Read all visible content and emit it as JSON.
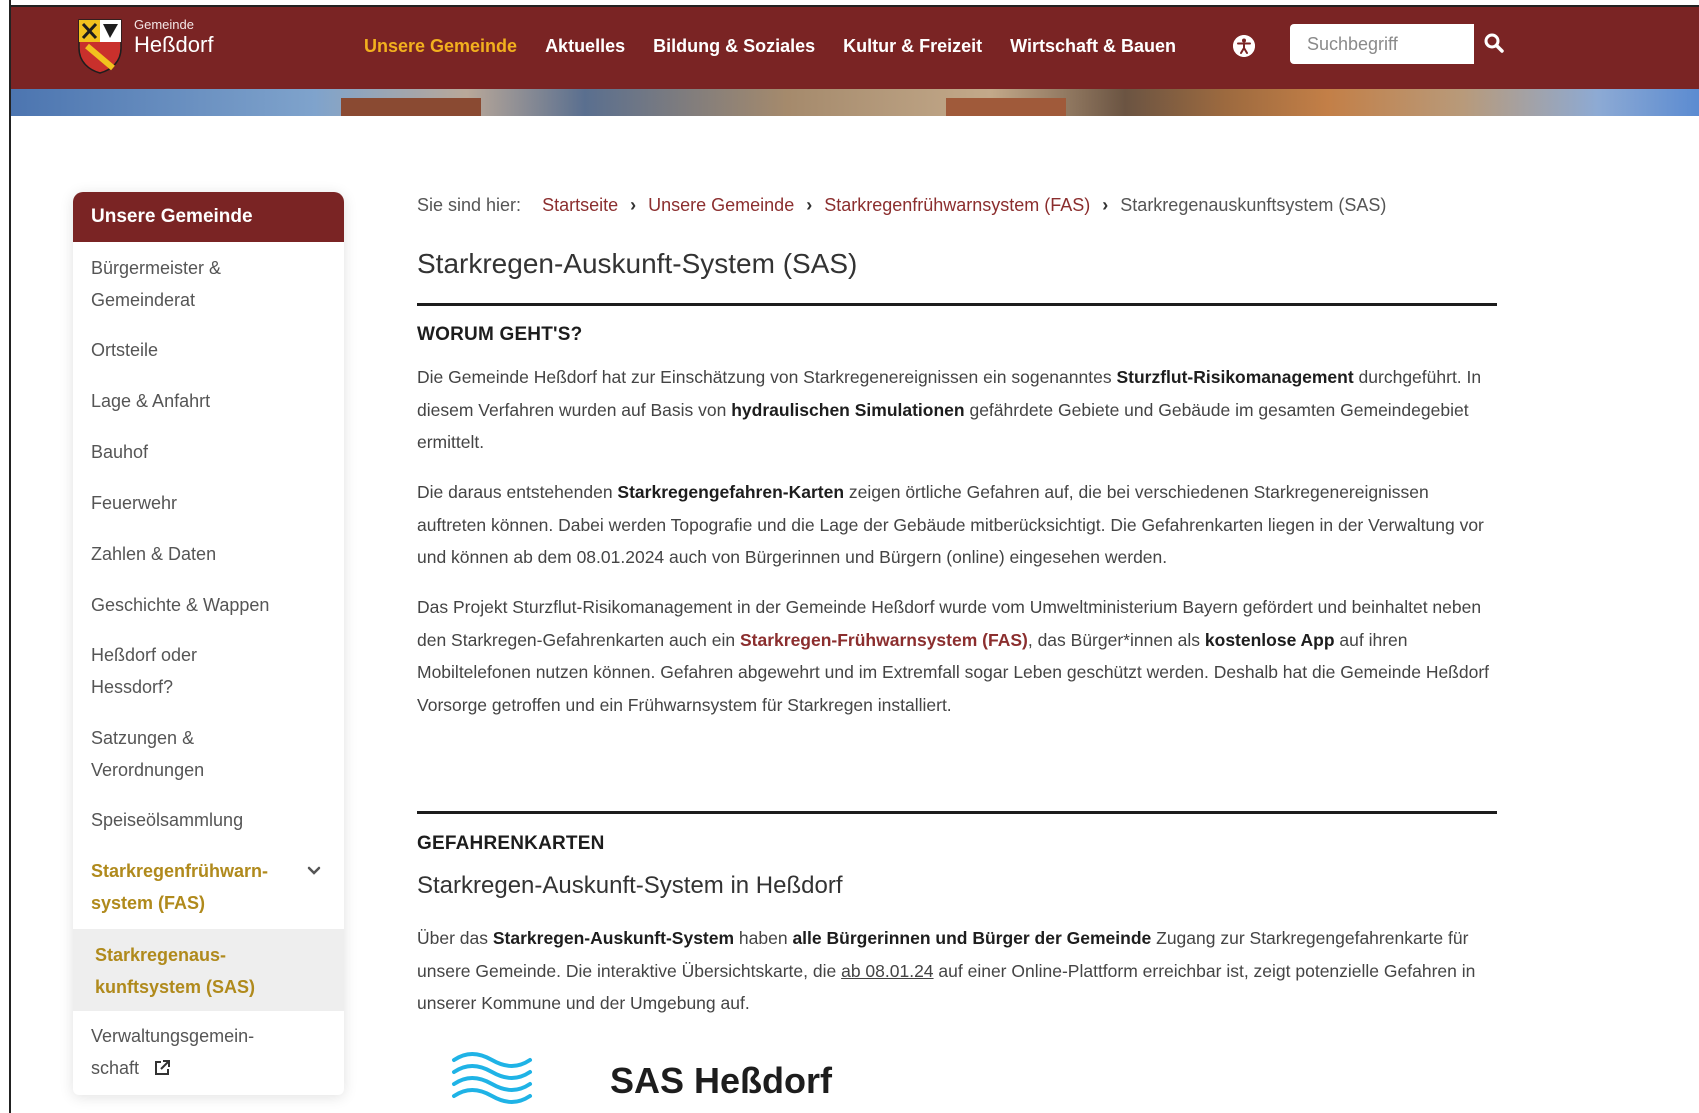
{
  "header": {
    "logo_sub": "Gemeinde",
    "logo_main": "Heßdorf",
    "nav": [
      "Unsere Gemeinde",
      "Aktuelles",
      "Bildung & Soziales",
      "Kultur & Freizeit",
      "Wirtschaft & Bauen"
    ],
    "search_placeholder": "Suchbegriff",
    "colors": {
      "brand": "#7a2424",
      "nav_active": "#f2b01e"
    }
  },
  "sidebar": {
    "title": "Unsere Gemeinde",
    "items": [
      "Bürgermeister &",
      "Gemeinderat",
      "Ortsteile",
      "Lage & Anfahrt",
      "Bauhof",
      "Feuerwehr",
      "Zahlen & Daten",
      "Geschichte & Wappen",
      "Heßdorf oder",
      "Hessdorf?",
      "Satzungen &",
      "Verordnungen",
      "Speiseölsammlung",
      "Starkregenfrühwarn-",
      "system (FAS)",
      "Starkregenaus-",
      "kunftsystem (SAS)",
      "Verwaltungsgemein-",
      "schaft"
    ],
    "colors": {
      "highlight": "#b08a1c"
    }
  },
  "breadcrumb": {
    "prefix": "Sie sind hier:",
    "links": [
      "Startseite",
      "Unsere Gemeinde",
      "Starkregenfrühwarnsystem (FAS)"
    ],
    "current": "Starkregenauskunftsystem (SAS)"
  },
  "page": {
    "title": "Starkregen-Auskunft-System (SAS)",
    "section1": {
      "heading": "WORUM GEHT'S?",
      "p1": {
        "a": "Die Gemeinde Heßdorf hat zur Einschätzung von Starkregenereignissen ein sogenanntes ",
        "b1": "Sturzflut-Risikomanagement",
        "c": " durchgeführt. In diesem Verfahren wurden auf Basis von ",
        "b2": "hydraulischen Simulationen",
        "d": " gefährdete Gebiete und Gebäude im gesamten Gemeindegebiet ermittelt."
      },
      "p2": {
        "a": "Die daraus entstehenden ",
        "b1": "Starkregengefahren-Karten",
        "c": " zeigen örtliche Gefahren auf, die bei verschiedenen Starkregenereignissen auftreten können. Dabei werden Topografie und die Lage der Gebäude mitberücksichtigt. Die Gefahrenkarten liegen in der Verwaltung vor und können ab dem 08.01.2024 auch von Bürgerinnen und Bürgern (online) eingesehen werden."
      },
      "p3": {
        "a": "Das Projekt Sturzflut-Risikomanagement in der Gemeinde Heßdorf wurde vom Umweltministerium Bayern gefördert und beinhaltet neben den Starkregen-Gefahrenkarten auch ein ",
        "link": "Starkregen-Frühwarnsystem (FAS)",
        "b": ", das Bürger*innen als ",
        "b1": "kostenlose App",
        "c": " auf ihren Mobiltelefonen nutzen können. Gefahren abgewehrt und im Extremfall sogar Leben geschützt werden. Deshalb hat die Gemeinde Heßdorf Vorsorge getroffen und ein Frühwarnsystem für Starkregen installiert."
      }
    },
    "section2": {
      "heading": "GEFAHRENKARTEN",
      "subtitle": "Starkregen-Auskunft-System in Heßdorf",
      "p1": {
        "a": "Über das ",
        "b1": "Starkregen-Auskunft-System",
        "c": " haben ",
        "b2": "alle Bürgerinnen und Bürger der Gemeinde",
        "d": " Zugang zur Starkregengefahrenkarte für unsere Gemeinde. Die interaktive Übersichtskarte, die ",
        "date": "ab 08.01.24",
        "e": " auf einer Online-Plattform erreichbar ist, zeigt potenzielle Gefahren in unserer Kommune und der Umgebung auf."
      },
      "logo_text": "SAS Heßdorf",
      "colors": {
        "wave": "#1fb3e6"
      }
    }
  }
}
